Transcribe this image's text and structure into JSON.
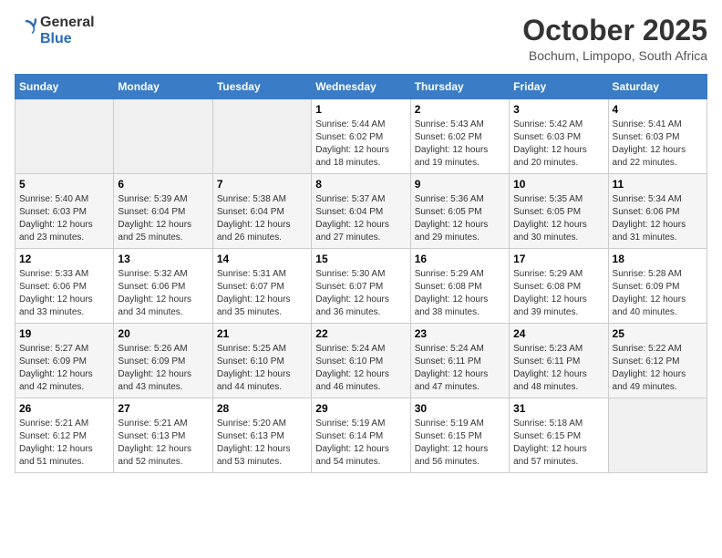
{
  "logo": {
    "text_general": "General",
    "text_blue": "Blue"
  },
  "header": {
    "month_title": "October 2025",
    "subtitle": "Bochum, Limpopo, South Africa"
  },
  "days_of_week": [
    "Sunday",
    "Monday",
    "Tuesday",
    "Wednesday",
    "Thursday",
    "Friday",
    "Saturday"
  ],
  "weeks": [
    [
      {
        "day": "",
        "info": ""
      },
      {
        "day": "",
        "info": ""
      },
      {
        "day": "",
        "info": ""
      },
      {
        "day": "1",
        "info": "Sunrise: 5:44 AM\nSunset: 6:02 PM\nDaylight: 12 hours\nand 18 minutes."
      },
      {
        "day": "2",
        "info": "Sunrise: 5:43 AM\nSunset: 6:02 PM\nDaylight: 12 hours\nand 19 minutes."
      },
      {
        "day": "3",
        "info": "Sunrise: 5:42 AM\nSunset: 6:03 PM\nDaylight: 12 hours\nand 20 minutes."
      },
      {
        "day": "4",
        "info": "Sunrise: 5:41 AM\nSunset: 6:03 PM\nDaylight: 12 hours\nand 22 minutes."
      }
    ],
    [
      {
        "day": "5",
        "info": "Sunrise: 5:40 AM\nSunset: 6:03 PM\nDaylight: 12 hours\nand 23 minutes."
      },
      {
        "day": "6",
        "info": "Sunrise: 5:39 AM\nSunset: 6:04 PM\nDaylight: 12 hours\nand 25 minutes."
      },
      {
        "day": "7",
        "info": "Sunrise: 5:38 AM\nSunset: 6:04 PM\nDaylight: 12 hours\nand 26 minutes."
      },
      {
        "day": "8",
        "info": "Sunrise: 5:37 AM\nSunset: 6:04 PM\nDaylight: 12 hours\nand 27 minutes."
      },
      {
        "day": "9",
        "info": "Sunrise: 5:36 AM\nSunset: 6:05 PM\nDaylight: 12 hours\nand 29 minutes."
      },
      {
        "day": "10",
        "info": "Sunrise: 5:35 AM\nSunset: 6:05 PM\nDaylight: 12 hours\nand 30 minutes."
      },
      {
        "day": "11",
        "info": "Sunrise: 5:34 AM\nSunset: 6:06 PM\nDaylight: 12 hours\nand 31 minutes."
      }
    ],
    [
      {
        "day": "12",
        "info": "Sunrise: 5:33 AM\nSunset: 6:06 PM\nDaylight: 12 hours\nand 33 minutes."
      },
      {
        "day": "13",
        "info": "Sunrise: 5:32 AM\nSunset: 6:06 PM\nDaylight: 12 hours\nand 34 minutes."
      },
      {
        "day": "14",
        "info": "Sunrise: 5:31 AM\nSunset: 6:07 PM\nDaylight: 12 hours\nand 35 minutes."
      },
      {
        "day": "15",
        "info": "Sunrise: 5:30 AM\nSunset: 6:07 PM\nDaylight: 12 hours\nand 36 minutes."
      },
      {
        "day": "16",
        "info": "Sunrise: 5:29 AM\nSunset: 6:08 PM\nDaylight: 12 hours\nand 38 minutes."
      },
      {
        "day": "17",
        "info": "Sunrise: 5:29 AM\nSunset: 6:08 PM\nDaylight: 12 hours\nand 39 minutes."
      },
      {
        "day": "18",
        "info": "Sunrise: 5:28 AM\nSunset: 6:09 PM\nDaylight: 12 hours\nand 40 minutes."
      }
    ],
    [
      {
        "day": "19",
        "info": "Sunrise: 5:27 AM\nSunset: 6:09 PM\nDaylight: 12 hours\nand 42 minutes."
      },
      {
        "day": "20",
        "info": "Sunrise: 5:26 AM\nSunset: 6:09 PM\nDaylight: 12 hours\nand 43 minutes."
      },
      {
        "day": "21",
        "info": "Sunrise: 5:25 AM\nSunset: 6:10 PM\nDaylight: 12 hours\nand 44 minutes."
      },
      {
        "day": "22",
        "info": "Sunrise: 5:24 AM\nSunset: 6:10 PM\nDaylight: 12 hours\nand 46 minutes."
      },
      {
        "day": "23",
        "info": "Sunrise: 5:24 AM\nSunset: 6:11 PM\nDaylight: 12 hours\nand 47 minutes."
      },
      {
        "day": "24",
        "info": "Sunrise: 5:23 AM\nSunset: 6:11 PM\nDaylight: 12 hours\nand 48 minutes."
      },
      {
        "day": "25",
        "info": "Sunrise: 5:22 AM\nSunset: 6:12 PM\nDaylight: 12 hours\nand 49 minutes."
      }
    ],
    [
      {
        "day": "26",
        "info": "Sunrise: 5:21 AM\nSunset: 6:12 PM\nDaylight: 12 hours\nand 51 minutes."
      },
      {
        "day": "27",
        "info": "Sunrise: 5:21 AM\nSunset: 6:13 PM\nDaylight: 12 hours\nand 52 minutes."
      },
      {
        "day": "28",
        "info": "Sunrise: 5:20 AM\nSunset: 6:13 PM\nDaylight: 12 hours\nand 53 minutes."
      },
      {
        "day": "29",
        "info": "Sunrise: 5:19 AM\nSunset: 6:14 PM\nDaylight: 12 hours\nand 54 minutes."
      },
      {
        "day": "30",
        "info": "Sunrise: 5:19 AM\nSunset: 6:15 PM\nDaylight: 12 hours\nand 56 minutes."
      },
      {
        "day": "31",
        "info": "Sunrise: 5:18 AM\nSunset: 6:15 PM\nDaylight: 12 hours\nand 57 minutes."
      },
      {
        "day": "",
        "info": ""
      }
    ]
  ]
}
